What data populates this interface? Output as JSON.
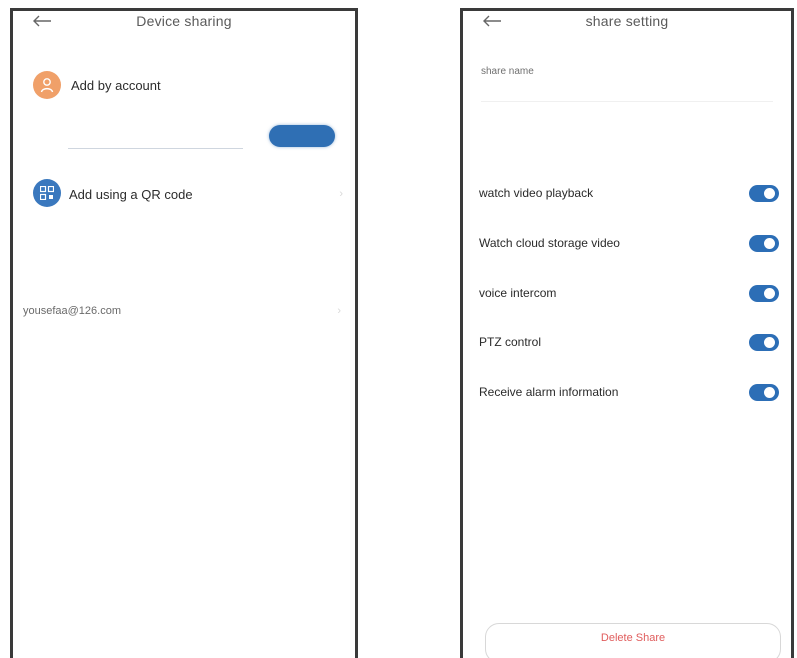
{
  "left_screen": {
    "title": "Device sharing",
    "add_by_account_label": "Add by account",
    "account_input_placeholder": "",
    "confirm_button_label": "",
    "add_qr_label": "Add using a QR code",
    "shared_section_label": "",
    "shared_account": "yousefaa@126.com"
  },
  "right_screen": {
    "title": "share setting",
    "share_name_label": "share name",
    "share_name_value": "",
    "permissions_title": "",
    "permissions": [
      {
        "label": "watch video playback",
        "enabled": true
      },
      {
        "label": "Watch cloud storage video",
        "enabled": true
      },
      {
        "label": "voice intercom",
        "enabled": true
      },
      {
        "label": "PTZ control",
        "enabled": true
      },
      {
        "label": "Receive alarm information",
        "enabled": true
      }
    ],
    "delete_button_label": "Delete Share"
  },
  "colors": {
    "accent": "#2c6eb6",
    "avatar": "#f0a069",
    "danger": "#e05c5c"
  },
  "icons": {
    "back": "arrow-left-icon",
    "account": "user-icon",
    "qr": "qr-code-icon"
  }
}
